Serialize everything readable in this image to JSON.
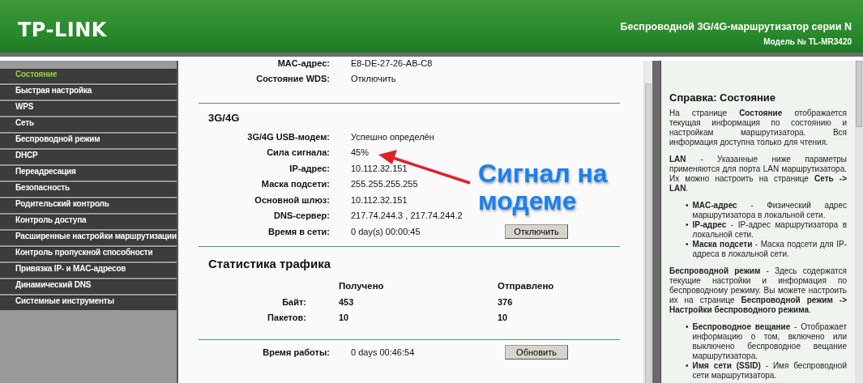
{
  "header": {
    "logo": "TP-LINK",
    "product": "Беспроводной 3G/4G-маршрутизатор серии N",
    "model": "Модель № TL-MR3420"
  },
  "sidebar": {
    "items": [
      {
        "label": "Состояние",
        "selected": true
      },
      {
        "label": "Быстрая настройка",
        "selected": false
      },
      {
        "label": "WPS",
        "selected": false
      },
      {
        "label": "Сеть",
        "selected": false
      },
      {
        "label": "Беспроводной режим",
        "selected": false
      },
      {
        "label": "DHCP",
        "selected": false
      },
      {
        "label": "Переадресация",
        "selected": false
      },
      {
        "label": "Безопасность",
        "selected": false
      },
      {
        "label": "Родительский контроль",
        "selected": false
      },
      {
        "label": "Контроль доступа",
        "selected": false
      },
      {
        "label": "Расширенные настройки маршрутизации",
        "selected": false
      },
      {
        "label": "Контроль пропускной способности",
        "selected": false
      },
      {
        "label": "Привязка IP- и MAC-адресов",
        "selected": false
      },
      {
        "label": "Динамический DNS",
        "selected": false
      },
      {
        "label": "Системные инструменты",
        "selected": false
      }
    ]
  },
  "lan_tail": {
    "rows": [
      {
        "label": "MAC-адрес:",
        "value": "E8-DE-27-26-AB-C8"
      },
      {
        "label": "Состояние WDS:",
        "value": "Отключить"
      }
    ]
  },
  "modem": {
    "title": "3G/4G",
    "rows": [
      {
        "label": "3G/4G USB-модем:",
        "value": "Успешно определён"
      },
      {
        "label": "Сила сигнала:",
        "value": "45%"
      },
      {
        "label": "IP-адрес:",
        "value": "10.112.32.151"
      },
      {
        "label": "Маска подсети:",
        "value": "255.255.255.255"
      },
      {
        "label": "Основной шлюз:",
        "value": "10.112.32.151"
      },
      {
        "label": "DNS-сервер:",
        "value": "217.74.244.3 , 217.74.244.2"
      },
      {
        "label": "Время в сети:",
        "value": "0 day(s) 00:00:45",
        "button": "Отключить"
      }
    ]
  },
  "traffic": {
    "title": "Статистика трафика",
    "columns": [
      "Получено",
      "Отправлено"
    ],
    "rows": [
      {
        "label": "Байт:",
        "received": "453",
        "sent": "376"
      },
      {
        "label": "Пакетов:",
        "received": "10",
        "sent": "10"
      }
    ]
  },
  "uptime": {
    "label": "Время работы:",
    "value": "0 days 00:46:54",
    "button": "Обновить"
  },
  "annotation": {
    "text": "Сигнал на модеме"
  },
  "help": {
    "title": "Справка: Состояние",
    "blocks": [
      {
        "kind": "paragraph",
        "text": "На странице **Состояние** отображается текущая информация по состоянию и настройкам маршрутизатора. Вся информация доступна только для чтения."
      },
      {
        "kind": "paragraph",
        "text": "**LAN** - Указанные ниже параметры применяются для порта LAN маршрутизатора. Их можно настроить на странице **Сеть -> LAN**."
      },
      {
        "kind": "list",
        "bullet": "•",
        "items": [
          "**MAC-адрес** - Физический адрес маршрутизатора в локальной сети.",
          "**IP-адрес** - IP-адрес маршрутизатора в локальной сети.",
          "**Маска подсети** - Маска подсети для IP-адреса в локальной сети."
        ]
      },
      {
        "kind": "paragraph",
        "text": "**Беспроводной режим** - Здесь содержатся текущие настройки и информация по беспроводному режиму. Вы можете настроить их на странице **Беспроводной режим -> Настройки беспроводного режима**."
      },
      {
        "kind": "list",
        "bullet": "•",
        "items": [
          "**Беспроводное вещание** - Отображает информацию о том, включено или выключено беспроводное вещание маршрутизатора.",
          "**Имя сети (SSID)** - Имя беспроводной сети маршрутизатора."
        ]
      }
    ]
  }
}
